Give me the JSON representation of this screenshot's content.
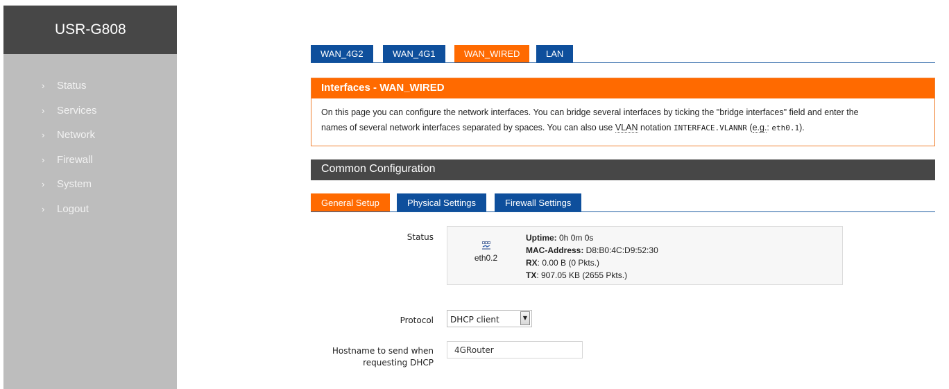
{
  "brand": "USR-G808",
  "sidebar": {
    "items": [
      {
        "label": "Status"
      },
      {
        "label": "Services"
      },
      {
        "label": "Network"
      },
      {
        "label": "Firewall"
      },
      {
        "label": "System"
      },
      {
        "label": "Logout"
      }
    ]
  },
  "tabs": [
    {
      "label": "WAN_4G2"
    },
    {
      "label": "WAN_4G1"
    },
    {
      "label": "WAN_WIRED",
      "active": true
    },
    {
      "label": "LAN"
    }
  ],
  "panel": {
    "title": "Interfaces - WAN_WIRED",
    "line1": "On this page you can configure the network interfaces. You can bridge several interfaces by ticking the \"bridge interfaces\" field and enter the",
    "line2_a": "names of several network interfaces separated by spaces. You can also use ",
    "line2_vlan": "VLAN",
    "line2_b": " notation ",
    "line2_code": "INTERFACE.VLANNR",
    "line2_c": " (",
    "line2_eg": "e.g.",
    "line2_d": ": ",
    "line2_code2": "eth0.1",
    "line2_e": ")."
  },
  "section": {
    "title": "Common Configuration"
  },
  "subtabs": [
    {
      "label": "General Setup",
      "active": true
    },
    {
      "label": "Physical Settings"
    },
    {
      "label": "Firewall Settings"
    }
  ],
  "status": {
    "label": "Status",
    "iface_name": "eth0.2",
    "icon": "ethernet-port-icon",
    "uptime_label": "Uptime:",
    "uptime_value": " 0h 0m 0s",
    "mac_label": "MAC-Address:",
    "mac_value": " D8:B0:4C:D9:52:30",
    "rx_label": "RX",
    "rx_value": ": 0.00 B (0 Pkts.)",
    "tx_label": "TX",
    "tx_value": ": 907.05 KB (2655 Pkts.)"
  },
  "protocol": {
    "label": "Protocol",
    "value": "DHCP client"
  },
  "hostname": {
    "label_line1": "Hostname to send when",
    "label_line2": "requesting DHCP",
    "value": "4GRouter"
  },
  "colors": {
    "accent_orange": "#ff6a00",
    "tab_blue": "#0e4f9c",
    "dark_header": "#474747",
    "sidebar_bg": "#bdbdbd"
  }
}
